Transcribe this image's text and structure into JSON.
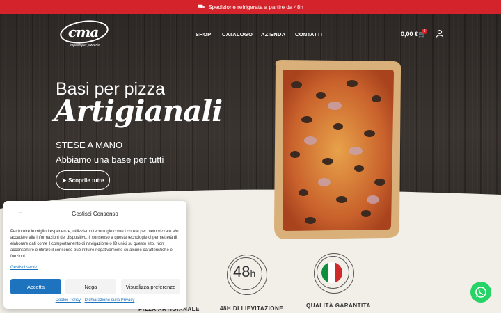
{
  "topbar": {
    "icon": "truck-icon",
    "text": "Spedizione refrigerata a partire da 48h"
  },
  "logo": {
    "name": "cma",
    "tagline": "impasti per pizzerie"
  },
  "menu": [
    {
      "label": "SHOP"
    },
    {
      "label": "CATALOGO"
    },
    {
      "label": "AZIENDA"
    },
    {
      "label": "CONTATTI"
    }
  ],
  "cart": {
    "total": "0,00 €",
    "count": "0"
  },
  "hero": {
    "title": "Basi per pizza",
    "script": "Artigianali",
    "subtitle1": "STESE A MANO",
    "subtitle2": "Abbiamo una base per tutti",
    "button": "Scoprile tutte"
  },
  "features": [
    {
      "label": "PIZZA ARTIGIANALE"
    },
    {
      "label": "48H DI LIEVITAZIONE",
      "badge_num": "48",
      "badge_unit": "h"
    },
    {
      "label": "QUALITÀ GARANTITA",
      "flag_colors": [
        "#0b8f3a",
        "#ffffff",
        "#cf2a2a"
      ]
    }
  ],
  "consent": {
    "title": "Gestisci Consenso",
    "body": "Per fornire le migliori esperienze, utilizziamo tecnologie come i cookie per memorizzare e/o accedere alle informazioni del dispositivo. Il consenso a queste tecnologie ci permetterà di elaborare dati come il comportamento di navigazione o ID unici su questo sito. Non acconsentire o ritirare il consenso può influire negativamente su alcune caratteristiche e funzioni.",
    "manage_link": "Gestisci servizi",
    "accept": "Accetta",
    "deny": "Nega",
    "preferences": "Visualizza preferenze",
    "cookie_policy": "Cookie Policy",
    "privacy": "Dichiarazione sulla Privacy"
  },
  "colors": {
    "brand_red": "#d4232a",
    "accept_blue": "#1e73be",
    "whatsapp_green": "#25d366"
  }
}
